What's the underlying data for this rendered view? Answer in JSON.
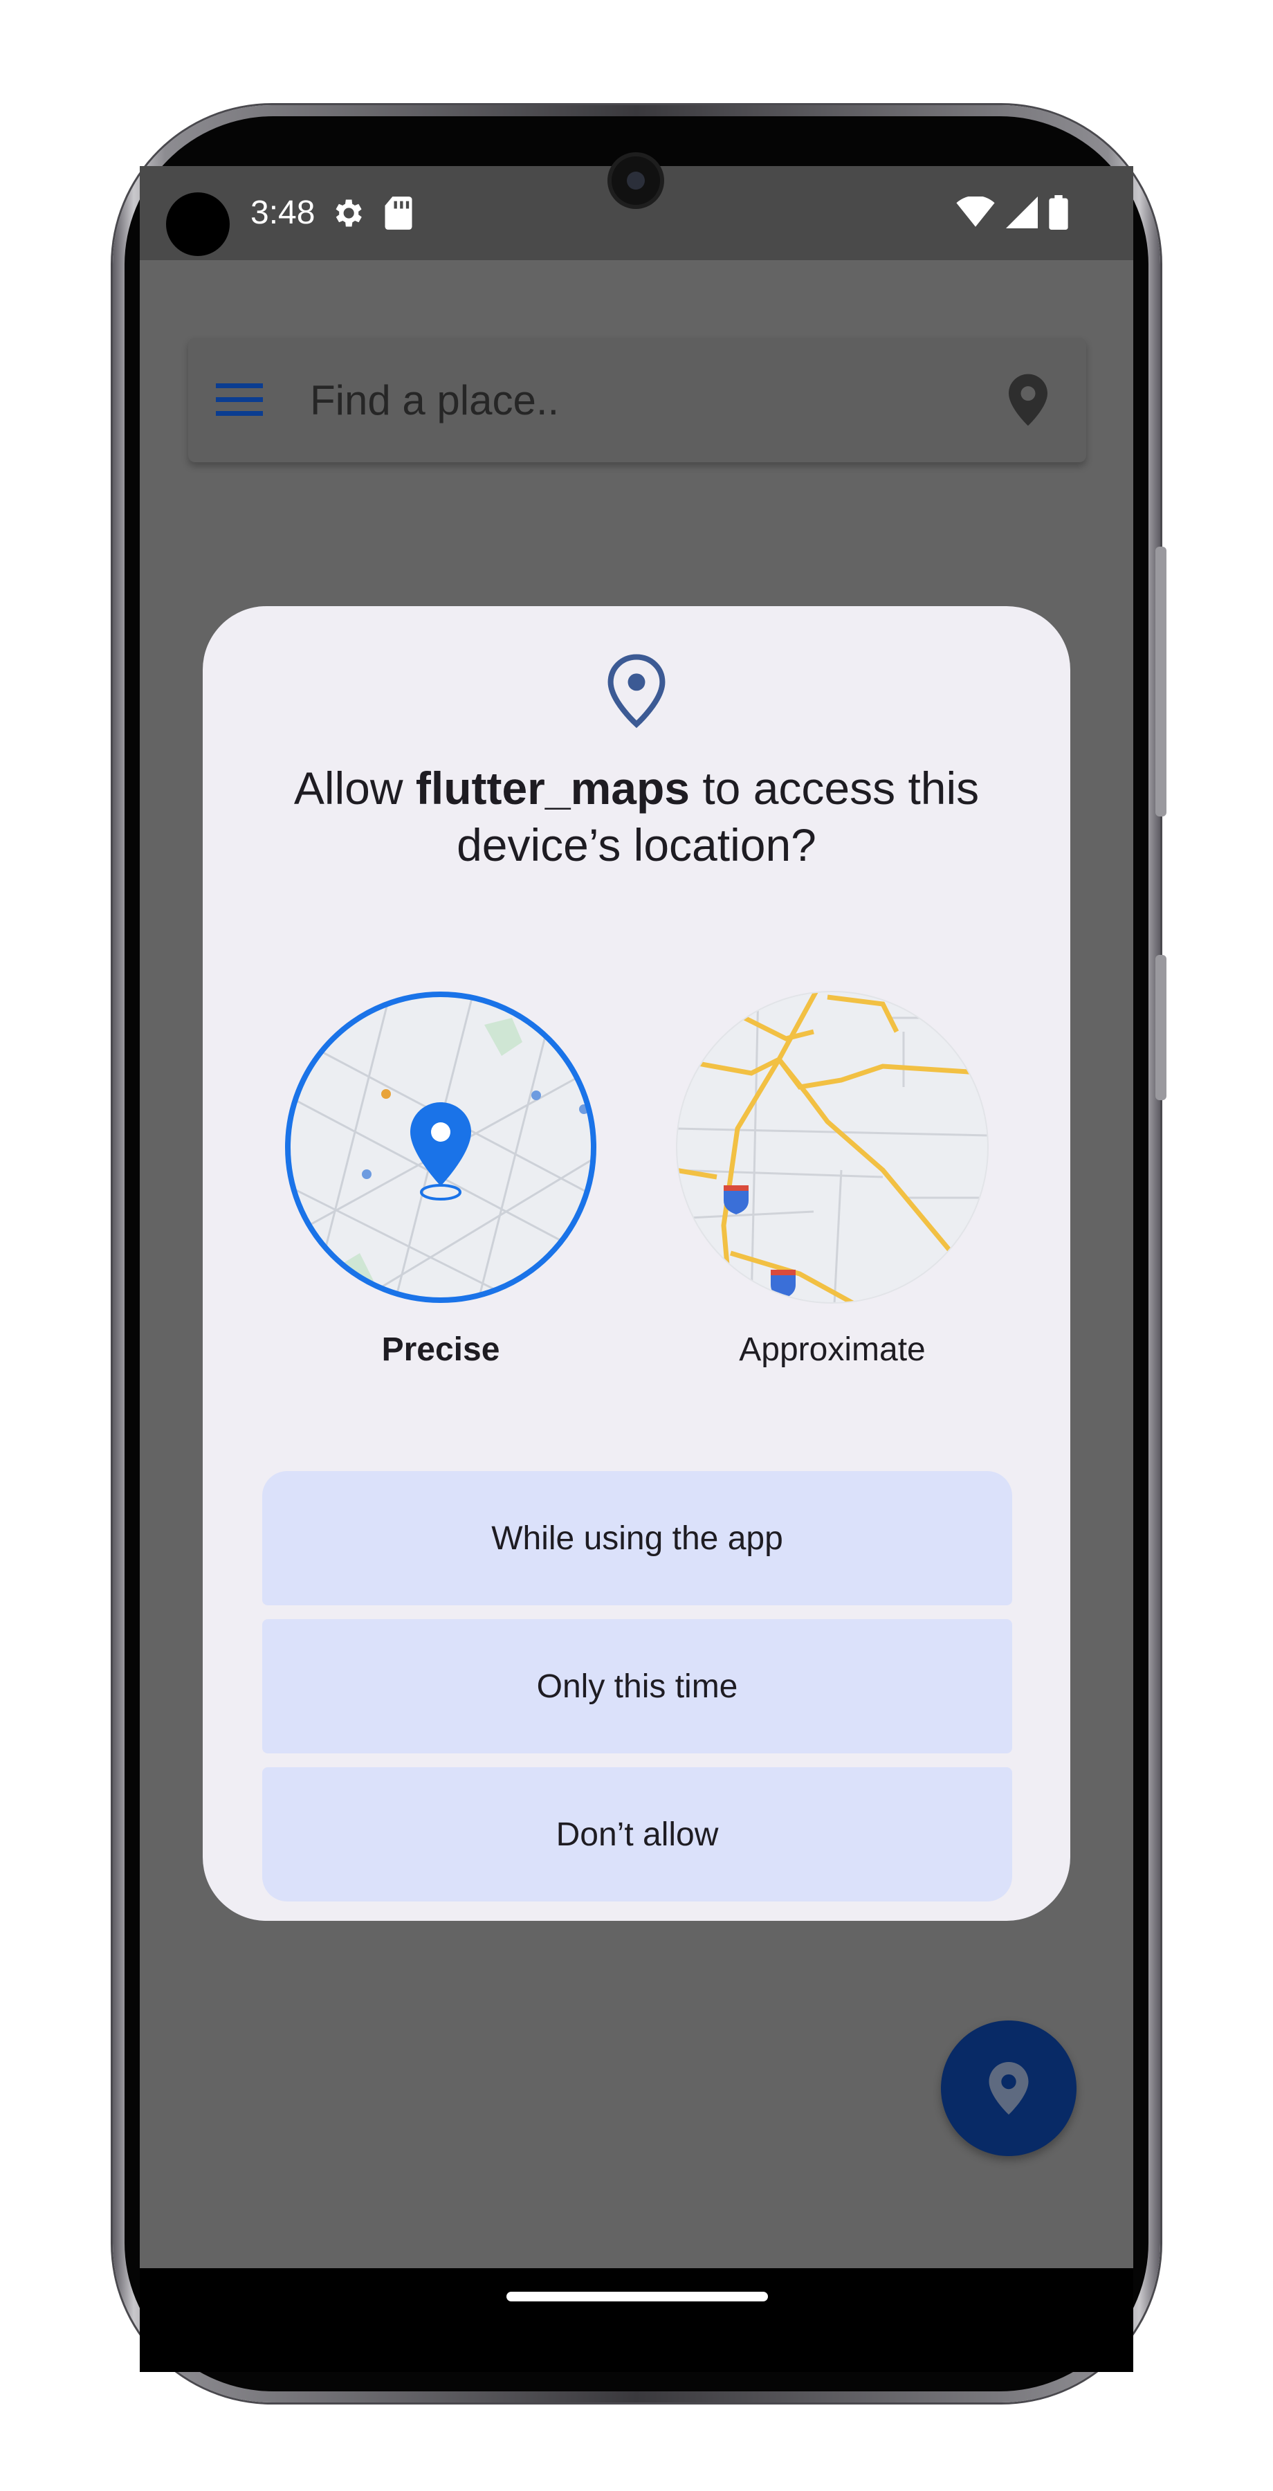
{
  "status_bar": {
    "time": "3:48",
    "left_icons": [
      "settings-icon",
      "sd-card-icon"
    ],
    "right_icons": [
      "wifi-icon",
      "cellular-signal-icon",
      "battery-icon"
    ]
  },
  "search_bar": {
    "placeholder": "Find a place..",
    "menu_icon": "menu-icon",
    "pin_icon": "location-pin-icon"
  },
  "permission_dialog": {
    "icon": "location-pin-outline-icon",
    "title_prefix": "Allow ",
    "app_name": "flutter_maps",
    "title_suffix": " to access this device’s location?",
    "options": {
      "precise": {
        "label": "Precise",
        "selected": true
      },
      "approximate": {
        "label": "Approximate",
        "selected": false
      }
    },
    "buttons": {
      "while_using": "While using the app",
      "only_this_time": "Only this time",
      "dont_allow": "Don’t allow"
    }
  },
  "fab": {
    "icon": "location-pin-icon"
  },
  "colors": {
    "scrim": "#646464",
    "dialog_bg": "#f0eef4",
    "button_bg": "#dbe1fa",
    "accent_blue": "#1a73e8",
    "fab_bg": "#082a66",
    "menu_icon": "#0b3d91"
  }
}
